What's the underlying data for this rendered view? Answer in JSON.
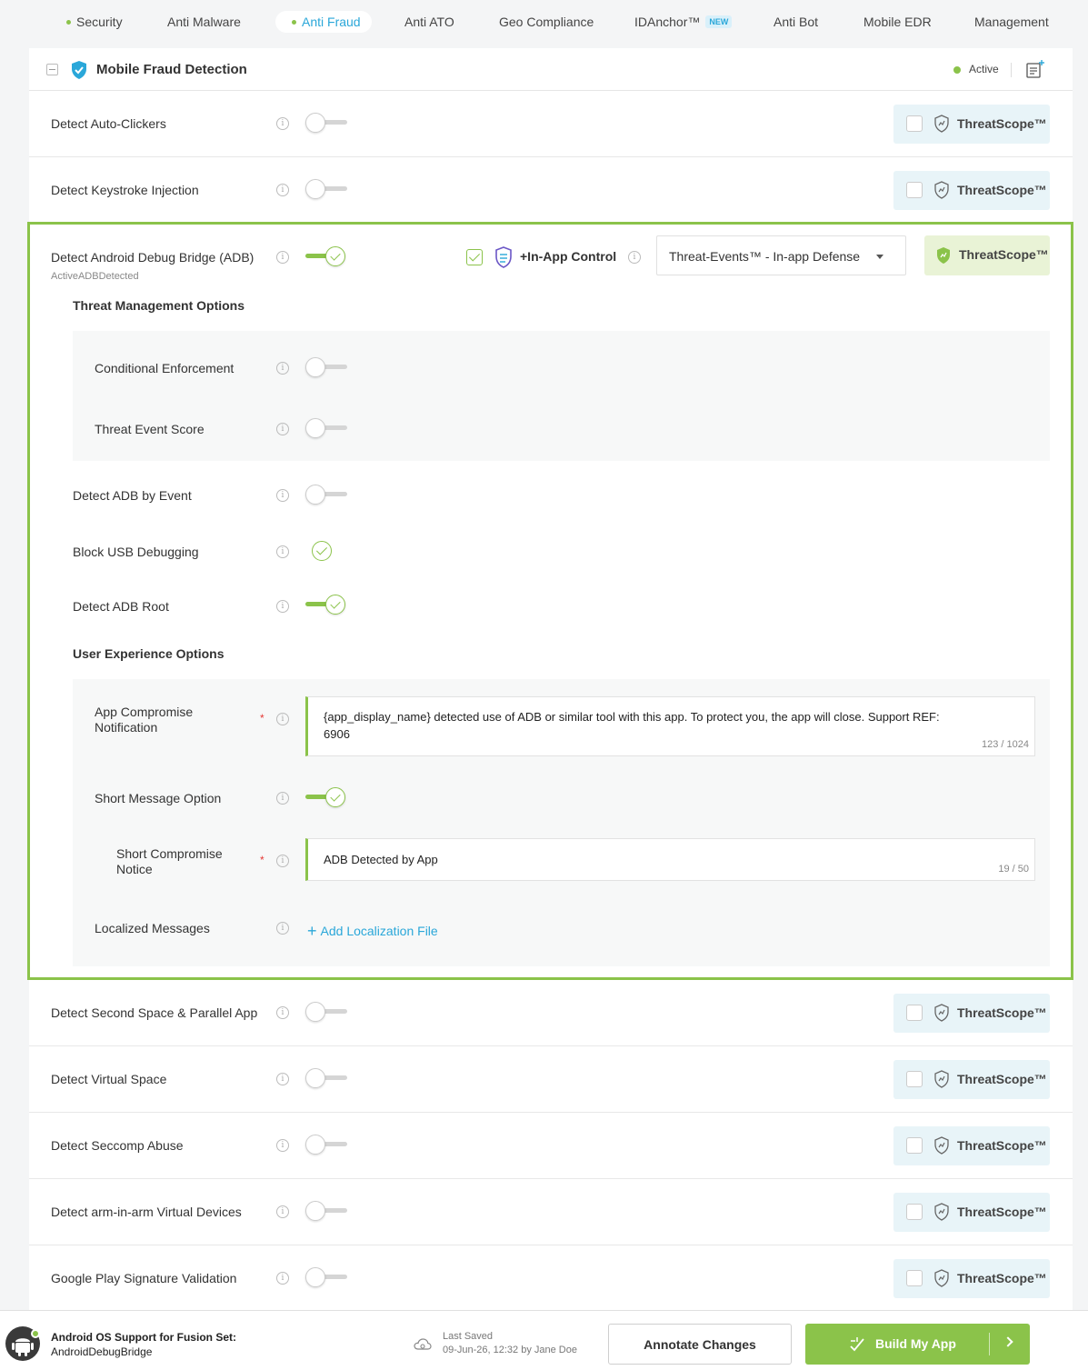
{
  "nav": {
    "tabs": [
      {
        "label": "Security"
      },
      {
        "label": "Anti Malware"
      },
      {
        "label": "Anti Fraud"
      },
      {
        "label": "Anti ATO"
      },
      {
        "label": "Geo Compliance"
      },
      {
        "label": "IDAnchor™",
        "badge": "NEW"
      },
      {
        "label": "Anti Bot"
      },
      {
        "label": "Mobile EDR"
      },
      {
        "label": "Management"
      }
    ],
    "active_tab": "Anti Fraud"
  },
  "card": {
    "title": "Mobile Fraud Detection",
    "status": "Active"
  },
  "threatscope_label": "ThreatScope™",
  "rows_top": [
    {
      "label": "Detect Auto-Clickers"
    },
    {
      "label": "Detect Keystroke Injection"
    }
  ],
  "adb": {
    "label": "Detect Android Debug Bridge (ADB)",
    "sublabel": "ActiveADBDetected",
    "in_app_control": "+In-App Control",
    "select_value": "Threat-Events™ - In-app Defense",
    "threat_management_heading": "Threat Management Options",
    "conditional_enforcement": "Conditional Enforcement",
    "threat_event_score": "Threat Event Score",
    "detect_by_event": "Detect ADB by Event",
    "block_usb": "Block USB Debugging",
    "detect_root": "Detect ADB Root",
    "ux_heading": "User Experience Options",
    "app_compromise_label_1": "App Compromise",
    "app_compromise_label_2": "Notification",
    "app_compromise_text_1": "{app_display_name} detected use of ADB or similar tool with this app. To protect you, the app will close. Support REF:",
    "app_compromise_text_2": "6906",
    "app_compromise_count": "123 / 1024",
    "short_message_option": "Short Message Option",
    "short_notice_label_1": "Short Compromise",
    "short_notice_label_2": "Notice",
    "short_notice_text": "ADB Detected by App",
    "short_notice_count": "19 / 50",
    "localized_messages": "Localized Messages",
    "add_localization": "Add Localization File",
    "required_mark": "*"
  },
  "rows_bottom": [
    {
      "label": "Detect Second Space & Parallel App"
    },
    {
      "label": "Detect Virtual Space"
    },
    {
      "label": "Detect Seccomp Abuse"
    },
    {
      "label": "Detect arm-in-arm Virtual Devices"
    },
    {
      "label": "Google Play Signature Validation"
    }
  ],
  "footer": {
    "title": "Android OS Support for Fusion Set:",
    "subtitle": "AndroidDebugBridge",
    "saved_title": "Last Saved",
    "saved_sub": "09-Jun-26, 12:32 by Jane Doe",
    "annotate_label": "Annotate Changes",
    "build_label": "Build My App"
  },
  "colors": {
    "accent_green": "#8bc34a",
    "accent_blue": "#2aa7d9",
    "threatscope_bg": "#e8f4f8"
  }
}
